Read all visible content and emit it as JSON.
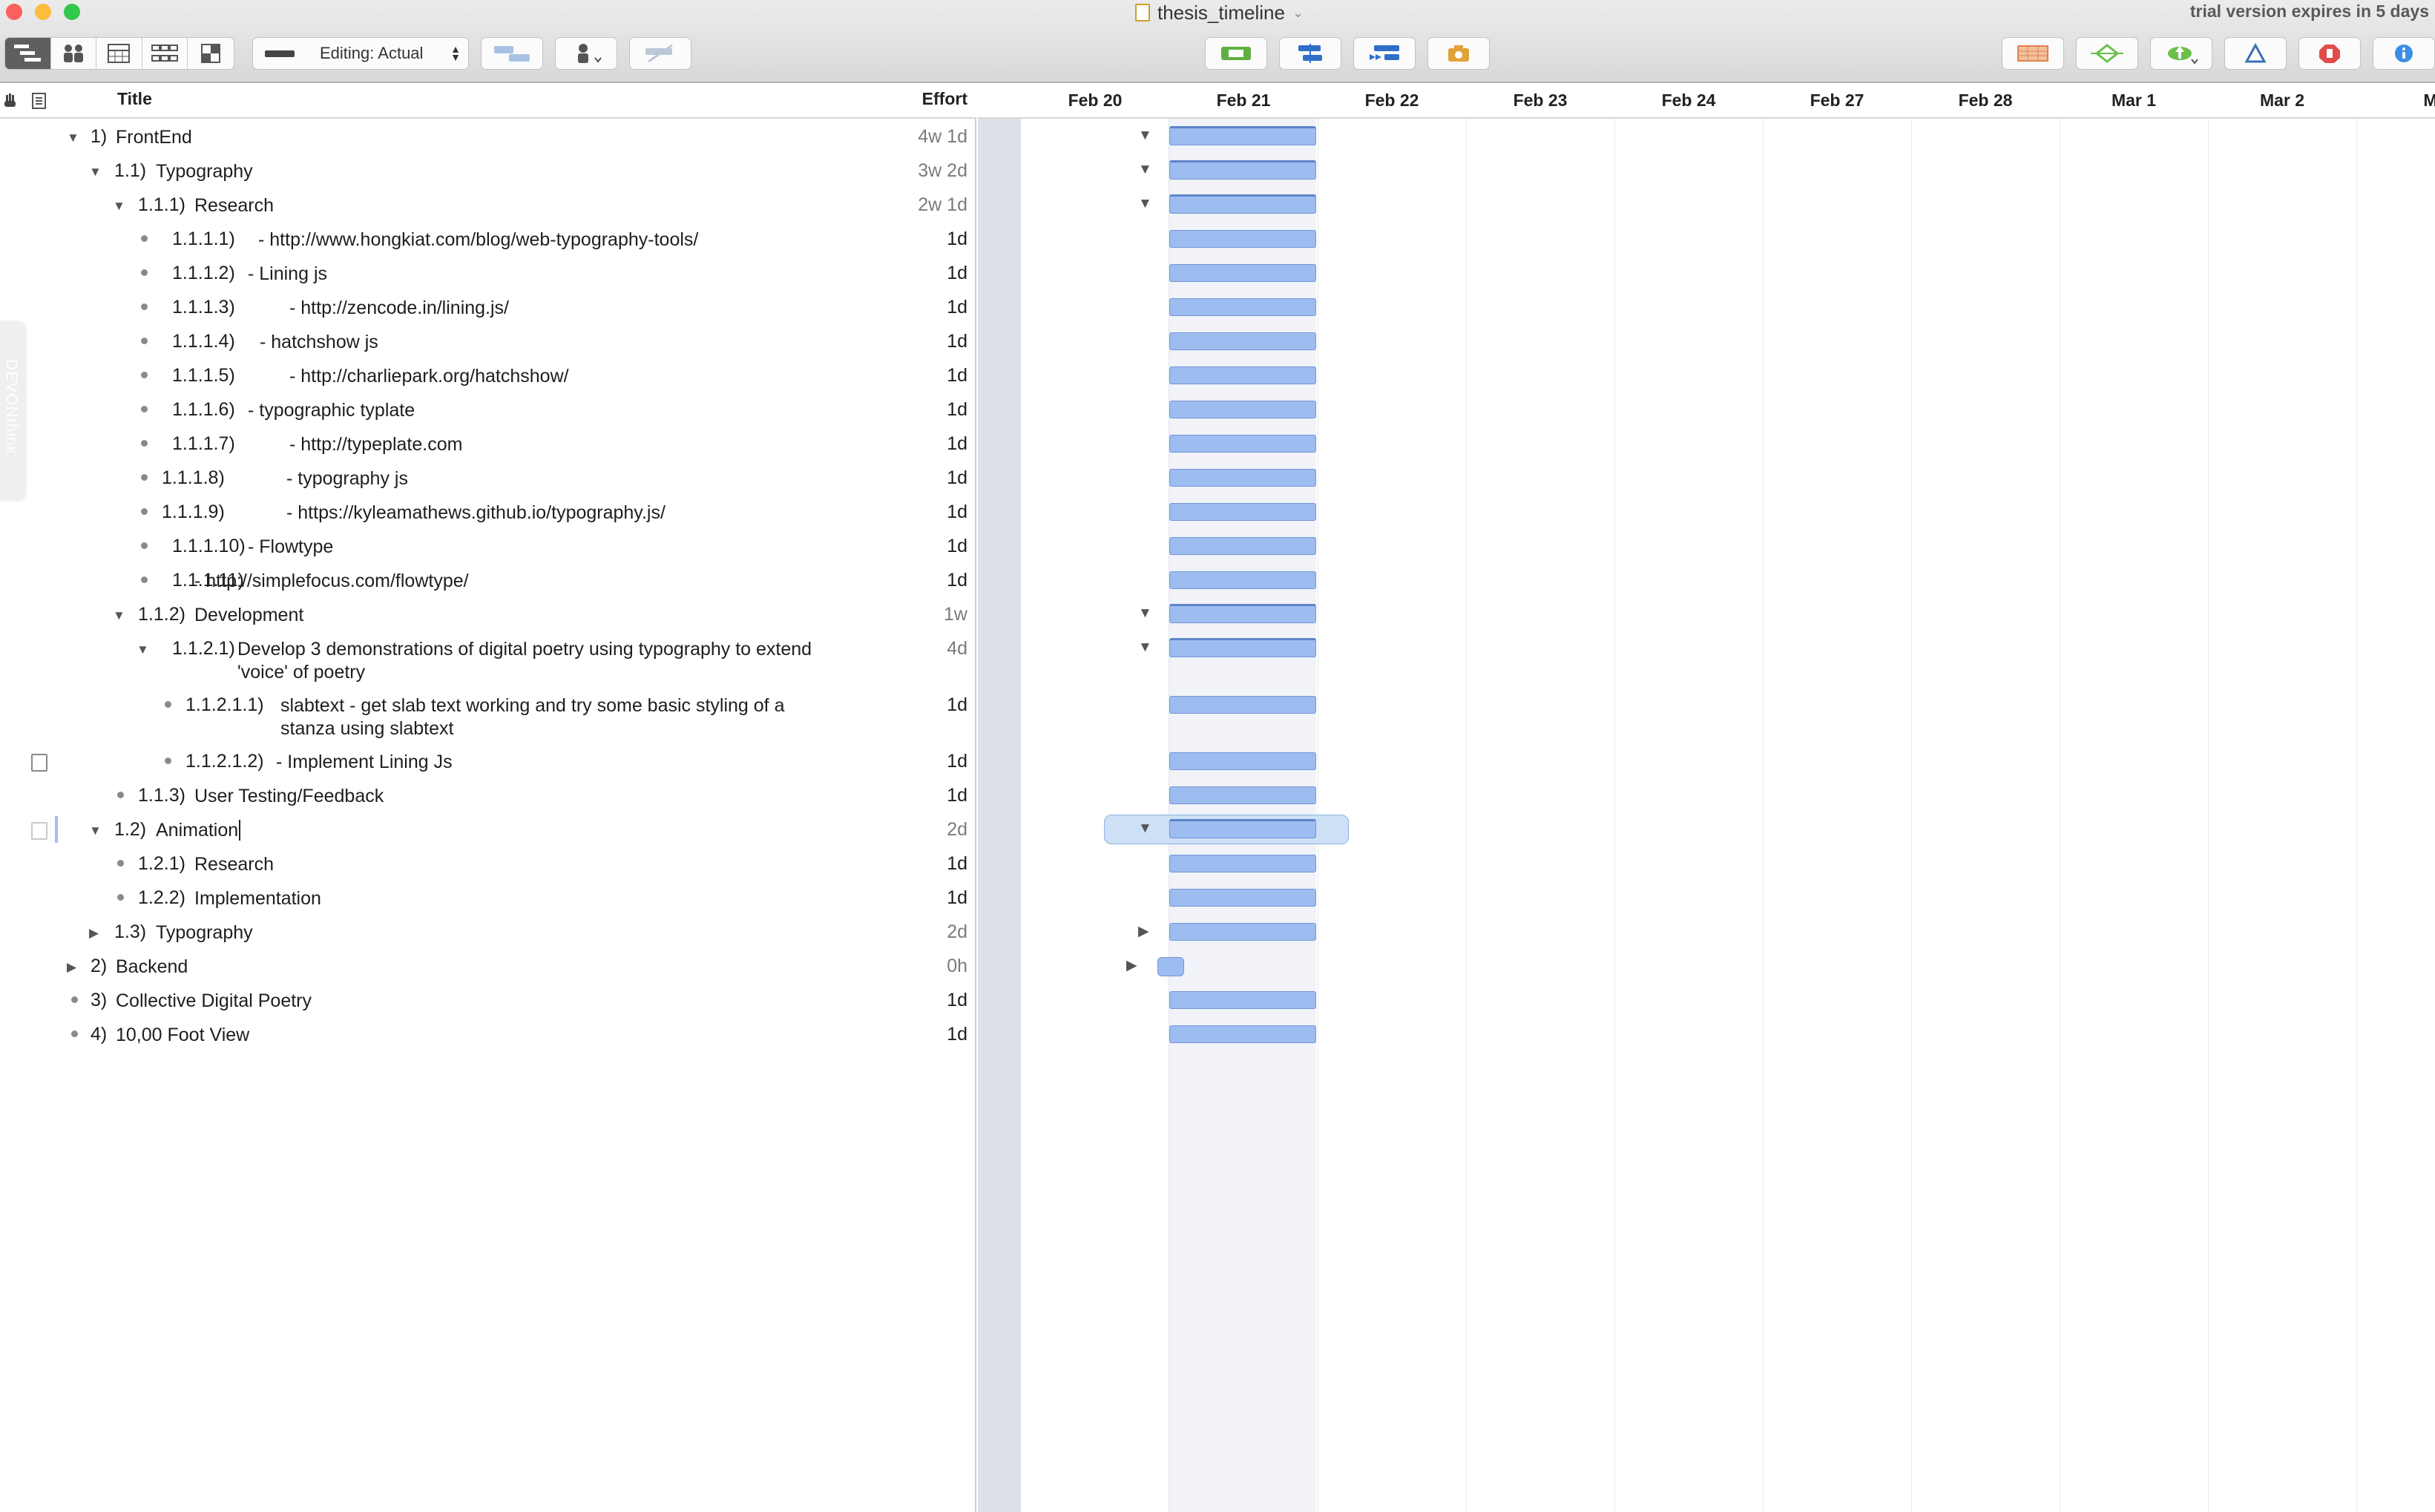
{
  "window": {
    "title": "thesis_timeline",
    "trial_notice": "trial version expires in 5 days",
    "colors": {
      "close": "#fc605c",
      "minimize": "#fdbc40",
      "zoom": "#34c84a"
    }
  },
  "toolbar": {
    "view_buttons": [
      "outline-view-icon",
      "resource-view-icon",
      "calendar-view-icon",
      "network-view-icon",
      "style-view-icon"
    ],
    "editing_popup": "Editing: Actual",
    "center_buttons": [
      "baseline-icon",
      "level-resources-icon",
      "catch-up-icon",
      "snapshot-camera-icon"
    ],
    "right_buttons": [
      "spreadsheet-icon",
      "sync-icon",
      "publish-cloud-icon",
      "inspector-triangle-icon",
      "violations-stop-icon",
      "info-icon"
    ]
  },
  "outline": {
    "headers": {
      "title": "Title",
      "effort": "Effort"
    },
    "rows": [
      {
        "num": "1)",
        "title": "FrontEnd",
        "effort": "4w 1d",
        "effort_parent": true
      },
      {
        "num": "1.1)",
        "title": "Typography",
        "effort": "3w 2d",
        "effort_parent": true
      },
      {
        "num": "1.1.1)",
        "title": "Research",
        "effort": "2w 1d",
        "effort_parent": true
      },
      {
        "num": "1.1.1.1)",
        "title": "- http://www.hongkiat.com/blog/web-typography-tools/",
        "effort": "1d"
      },
      {
        "num": "1.1.1.2)",
        "title": "- Lining js",
        "effort": "1d"
      },
      {
        "num": "1.1.1.3)",
        "title": "- http://zencode.in/lining.js/",
        "effort": "1d"
      },
      {
        "num": "1.1.1.4)",
        "title": "- hatchshow js",
        "effort": "1d"
      },
      {
        "num": "1.1.1.5)",
        "title": "- http://charliepark.org/hatchshow/",
        "effort": "1d"
      },
      {
        "num": "1.1.1.6)",
        "title": "- typographic typlate",
        "effort": "1d"
      },
      {
        "num": "1.1.1.7)",
        "title": "- http://typeplate.com",
        "effort": "1d"
      },
      {
        "num": "1.1.1.8)",
        "title": "- typography js",
        "effort": "1d"
      },
      {
        "num": "1.1.1.9)",
        "title": "- https://kyleamathews.github.io/typography.js/",
        "effort": "1d"
      },
      {
        "num": "1.1.1.10)",
        "title": "- Flowtype",
        "effort": "1d"
      },
      {
        "num": "1.1.1.11)",
        "title": "- http://simplefocus.com/flowtype/",
        "effort": "1d"
      },
      {
        "num": "1.1.2)",
        "title": "Development",
        "effort": "1w",
        "effort_parent": true
      },
      {
        "num": "1.1.2.1)",
        "title": "Develop 3 demonstrations of digital poetry using typography to extend 'voice' of poetry",
        "effort": "4d",
        "effort_parent": true
      },
      {
        "num": "1.1.2.1.1)",
        "title": "slabtext - get slab text working and try some basic styling of a stanza using slabtext",
        "effort": "1d"
      },
      {
        "num": "1.1.2.1.2)",
        "title": "- Implement Lining Js",
        "effort": "1d",
        "has_note": true
      },
      {
        "num": "1.1.3)",
        "title": "User Testing/Feedback",
        "effort": "1d"
      },
      {
        "num": "1.2)",
        "title": "Animation",
        "effort": "2d",
        "effort_parent": true,
        "selected": true
      },
      {
        "num": "1.2.1)",
        "title": "Research",
        "effort": "1d"
      },
      {
        "num": "1.2.2)",
        "title": "Implementation",
        "effort": "1d"
      },
      {
        "num": "1.3)",
        "title": "Typography",
        "effort": "2d",
        "effort_parent": true
      },
      {
        "num": "2)",
        "title": "Backend",
        "effort": "0h",
        "effort_parent": true
      },
      {
        "num": "3)",
        "title": "Collective Digital Poetry",
        "effort": "1d"
      },
      {
        "num": "4)",
        "title": "10,00 Foot View",
        "effort": "1d"
      }
    ]
  },
  "side_tab": {
    "label": "DEVONthink"
  },
  "gantt": {
    "dates": [
      "Feb 20",
      "Feb 21",
      "Feb 22",
      "Feb 23",
      "Feb 24",
      "Feb 27",
      "Feb 28",
      "Mar 1",
      "Mar 2",
      "M"
    ],
    "bar_color": "#9dbcf0",
    "today": "Feb 21"
  }
}
